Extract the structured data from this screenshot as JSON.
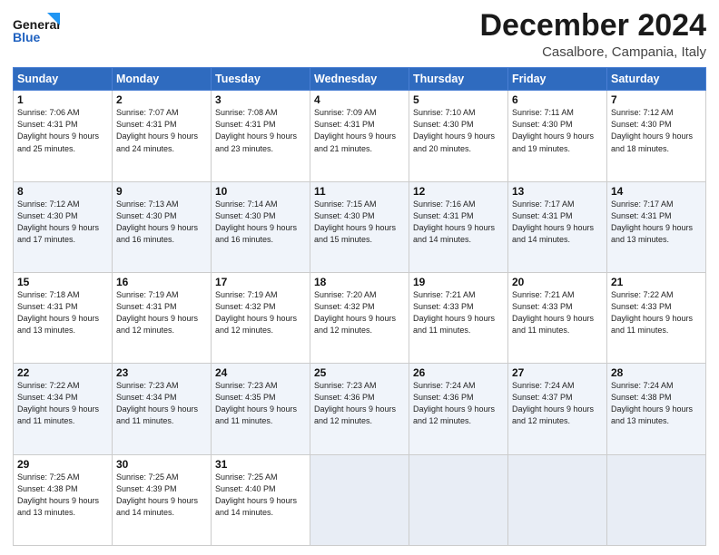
{
  "header": {
    "logo_line1": "General",
    "logo_line2": "Blue",
    "month_title": "December 2024",
    "location": "Casalbore, Campania, Italy"
  },
  "weekdays": [
    "Sunday",
    "Monday",
    "Tuesday",
    "Wednesday",
    "Thursday",
    "Friday",
    "Saturday"
  ],
  "weeks": [
    [
      {
        "day": "1",
        "sunrise": "7:06 AM",
        "sunset": "4:31 PM",
        "daylight": "9 hours and 25 minutes."
      },
      {
        "day": "2",
        "sunrise": "7:07 AM",
        "sunset": "4:31 PM",
        "daylight": "9 hours and 24 minutes."
      },
      {
        "day": "3",
        "sunrise": "7:08 AM",
        "sunset": "4:31 PM",
        "daylight": "9 hours and 23 minutes."
      },
      {
        "day": "4",
        "sunrise": "7:09 AM",
        "sunset": "4:31 PM",
        "daylight": "9 hours and 21 minutes."
      },
      {
        "day": "5",
        "sunrise": "7:10 AM",
        "sunset": "4:30 PM",
        "daylight": "9 hours and 20 minutes."
      },
      {
        "day": "6",
        "sunrise": "7:11 AM",
        "sunset": "4:30 PM",
        "daylight": "9 hours and 19 minutes."
      },
      {
        "day": "7",
        "sunrise": "7:12 AM",
        "sunset": "4:30 PM",
        "daylight": "9 hours and 18 minutes."
      }
    ],
    [
      {
        "day": "8",
        "sunrise": "7:12 AM",
        "sunset": "4:30 PM",
        "daylight": "9 hours and 17 minutes."
      },
      {
        "day": "9",
        "sunrise": "7:13 AM",
        "sunset": "4:30 PM",
        "daylight": "9 hours and 16 minutes."
      },
      {
        "day": "10",
        "sunrise": "7:14 AM",
        "sunset": "4:30 PM",
        "daylight": "9 hours and 16 minutes."
      },
      {
        "day": "11",
        "sunrise": "7:15 AM",
        "sunset": "4:30 PM",
        "daylight": "9 hours and 15 minutes."
      },
      {
        "day": "12",
        "sunrise": "7:16 AM",
        "sunset": "4:31 PM",
        "daylight": "9 hours and 14 minutes."
      },
      {
        "day": "13",
        "sunrise": "7:17 AM",
        "sunset": "4:31 PM",
        "daylight": "9 hours and 14 minutes."
      },
      {
        "day": "14",
        "sunrise": "7:17 AM",
        "sunset": "4:31 PM",
        "daylight": "9 hours and 13 minutes."
      }
    ],
    [
      {
        "day": "15",
        "sunrise": "7:18 AM",
        "sunset": "4:31 PM",
        "daylight": "9 hours and 13 minutes."
      },
      {
        "day": "16",
        "sunrise": "7:19 AM",
        "sunset": "4:31 PM",
        "daylight": "9 hours and 12 minutes."
      },
      {
        "day": "17",
        "sunrise": "7:19 AM",
        "sunset": "4:32 PM",
        "daylight": "9 hours and 12 minutes."
      },
      {
        "day": "18",
        "sunrise": "7:20 AM",
        "sunset": "4:32 PM",
        "daylight": "9 hours and 12 minutes."
      },
      {
        "day": "19",
        "sunrise": "7:21 AM",
        "sunset": "4:33 PM",
        "daylight": "9 hours and 11 minutes."
      },
      {
        "day": "20",
        "sunrise": "7:21 AM",
        "sunset": "4:33 PM",
        "daylight": "9 hours and 11 minutes."
      },
      {
        "day": "21",
        "sunrise": "7:22 AM",
        "sunset": "4:33 PM",
        "daylight": "9 hours and 11 minutes."
      }
    ],
    [
      {
        "day": "22",
        "sunrise": "7:22 AM",
        "sunset": "4:34 PM",
        "daylight": "9 hours and 11 minutes."
      },
      {
        "day": "23",
        "sunrise": "7:23 AM",
        "sunset": "4:34 PM",
        "daylight": "9 hours and 11 minutes."
      },
      {
        "day": "24",
        "sunrise": "7:23 AM",
        "sunset": "4:35 PM",
        "daylight": "9 hours and 11 minutes."
      },
      {
        "day": "25",
        "sunrise": "7:23 AM",
        "sunset": "4:36 PM",
        "daylight": "9 hours and 12 minutes."
      },
      {
        "day": "26",
        "sunrise": "7:24 AM",
        "sunset": "4:36 PM",
        "daylight": "9 hours and 12 minutes."
      },
      {
        "day": "27",
        "sunrise": "7:24 AM",
        "sunset": "4:37 PM",
        "daylight": "9 hours and 12 minutes."
      },
      {
        "day": "28",
        "sunrise": "7:24 AM",
        "sunset": "4:38 PM",
        "daylight": "9 hours and 13 minutes."
      }
    ],
    [
      {
        "day": "29",
        "sunrise": "7:25 AM",
        "sunset": "4:38 PM",
        "daylight": "9 hours and 13 minutes."
      },
      {
        "day": "30",
        "sunrise": "7:25 AM",
        "sunset": "4:39 PM",
        "daylight": "9 hours and 14 minutes."
      },
      {
        "day": "31",
        "sunrise": "7:25 AM",
        "sunset": "4:40 PM",
        "daylight": "9 hours and 14 minutes."
      },
      null,
      null,
      null,
      null
    ]
  ]
}
